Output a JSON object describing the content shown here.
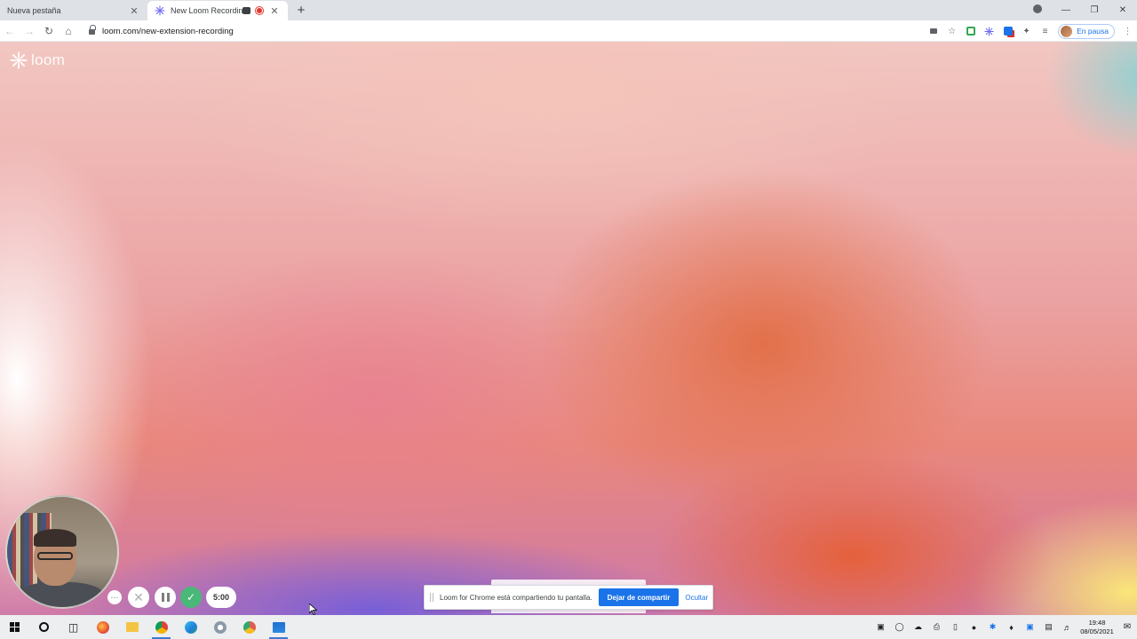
{
  "browser": {
    "tabs": [
      {
        "label": "Nueva pestaña",
        "active": false
      },
      {
        "label": "New Loom Recording",
        "active": true
      }
    ],
    "new_tab_symbol": "+",
    "close_symbol": "✕",
    "window_controls": {
      "minimize": "—",
      "restore": "❐",
      "close": "✕"
    },
    "url": "loom.com/new-extension-recording",
    "profile_status": "En pausa"
  },
  "page": {
    "logo_text": "loom",
    "recorder": {
      "more_symbol": "···",
      "cancel_symbol": "✕",
      "done_symbol": "✓",
      "timer": "5:00"
    },
    "sharing_bar": {
      "message": "Loom for Chrome está compartiendo tu pantalla.",
      "stop_label": "Dejar de compartir",
      "hide_label": "Ocultar"
    }
  },
  "taskbar": {
    "time": "19:48",
    "date": "08/05/2021"
  },
  "colors": {
    "chrome_accent": "#1a73e8",
    "recording_red": "#e3382b",
    "done_green": "#4ab879",
    "loom_purple": "#625df5"
  }
}
